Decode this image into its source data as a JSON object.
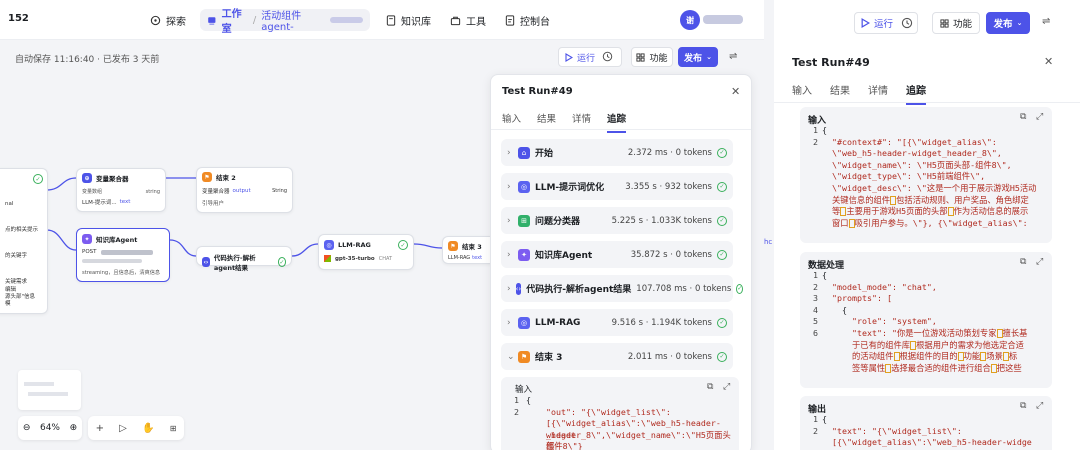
{
  "topbar": {
    "num": "152",
    "explore": "探索",
    "studio": "工作室",
    "project": "活动组件agent-",
    "knowledge": "知识库",
    "tools": "工具",
    "console": "控制台",
    "avatar": "谢"
  },
  "toolbar": {
    "autosave": "自动保存 11:16:40 · 已发布 3 天前",
    "run": "运行",
    "feature": "功能",
    "publish": "发布"
  },
  "canvas": {
    "n_left_lines": [
      "nal",
      "点的相关提示",
      "的关键字",
      "关键需求",
      "编辑",
      "源头部\"信息",
      "模"
    ],
    "var_agg": {
      "title": "变量聚合器",
      "l1": "变量数组",
      "l1r": "string",
      "l2": "LLM-提示词...",
      "l2b": "text"
    },
    "end2": {
      "title": "结束 2",
      "l1": "变量聚合器",
      "l1b": "output",
      "l1r": "String",
      "l2": "引导用户"
    },
    "kb_agent": {
      "title": "知识库Agent",
      "l1": "POST",
      "l2": "streaming，且信息后，清爽信息"
    },
    "code": {
      "title": "代码执行-解析agent结果"
    },
    "llm_rag": {
      "title": "LLM-RAG",
      "model": "gpt-35-turbo",
      "chat": "CHAT"
    },
    "end3": {
      "title": "结束 3",
      "l1": "LLM-RAG",
      "l1b": "text"
    },
    "zoom": "64%"
  },
  "panel1": {
    "title": "Test Run#49",
    "tabs": [
      "输入",
      "结果",
      "详情",
      "追踪"
    ],
    "rows": [
      {
        "name": "开始",
        "meta": "2.372 ms · 0 tokens",
        "color": "#4d53e8",
        "glyph": "⌂"
      },
      {
        "name": "LLM-提示词优化",
        "meta": "3.355 s · 932 tokens",
        "color": "#5b62f0",
        "glyph": "◎"
      },
      {
        "name": "问题分类器",
        "meta": "5.225 s · 1.033K tokens",
        "color": "#31b06a",
        "glyph": "⊞"
      },
      {
        "name": "知识库Agent",
        "meta": "35.872 s · 0 tokens",
        "color": "#7c5cf0",
        "glyph": "✦"
      },
      {
        "name": "代码执行-解析agent结果",
        "meta": "107.708 ms · 0 tokens",
        "color": "#4d53e8",
        "glyph": "‹›"
      },
      {
        "name": "LLM-RAG",
        "meta": "9.516 s · 1.194K tokens",
        "color": "#5b62f0",
        "glyph": "◎"
      },
      {
        "name": "结束 3",
        "meta": "2.011 ms · 0 tokens",
        "color": "#f08a24",
        "glyph": "⚑"
      }
    ],
    "input_label": "输入",
    "code": [
      "{",
      "\"out\": \"{\\\"widget_list\\\":",
      "[{\\\"widget_alias\\\":\\\"web_h5-header-widget",
      "_header_8\\\",\\\"widget_name\\\":\\\"H5页面头部-",
      "组件8\\\"}"
    ]
  },
  "panel2": {
    "run": "运行",
    "feature": "功能",
    "publish": "发布",
    "title": "Test Run#49",
    "tabs": [
      "输入",
      "结果",
      "详情",
      "追踪"
    ],
    "sec1": "输入",
    "sec1_code": [
      "{",
      "\"#context#\": \"[{\\\"widget_alias\\\":",
      "\\\"web_h5-header-widget_header_8\\\",",
      "\\\"widget_name\\\": \\\"H5页面头部-组件8\\\",",
      "\\\"widget_type\\\": \\\"H5前端组件\\\",",
      "\\\"widget_desc\\\": \\\"这是一个用于展示游戏H5活动",
      "关键信息的组件",
      "包括活动规则、用户奖品、角色绑定",
      "等",
      "主要用于游戏H5页面的头部",
      "作为活动信息的展示",
      "窗口",
      "吸引用户参与。\\\"}, {\\\"widget_alias\\\":"
    ],
    "sec2": "数据处理",
    "sec2_code": [
      "{",
      "\"model_mode\": \"chat\",",
      "\"prompts\": [",
      "{",
      "\"role\": \"system\",",
      "\"text\": \"你是一位游戏活动策划专家",
      "擅长基",
      "于已有的组件库",
      "根据用户的需求为他选定合适",
      "的活动组件",
      "根据组件的目的",
      "功能",
      "场景",
      "标",
      "签等属性",
      "选择最合适的组件进行组合",
      "把这些"
    ],
    "sec3": "输出",
    "sec3_code": [
      "{",
      "\"text\": \"{\\\"widget_list\\\":",
      "[{\\\"widget_alias\\\":\\\"web_h5-header-widge"
    ]
  }
}
